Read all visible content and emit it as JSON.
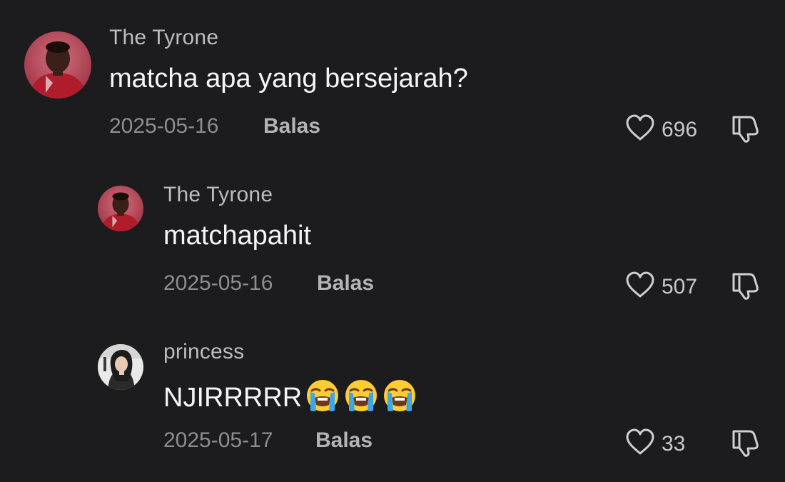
{
  "comments": [
    {
      "username": "The Tyrone",
      "text": "matcha apa yang bersejarah?",
      "date": "2025-05-16",
      "reply_label": "Balas",
      "likes": "696",
      "avatar": "person-red-jersey-avatar"
    },
    {
      "username": "The Tyrone",
      "text": "matchapahit",
      "date": "2025-05-16",
      "reply_label": "Balas",
      "likes": "507",
      "avatar": "person-red-jersey-avatar"
    },
    {
      "username": "princess",
      "text": "NJIRRRRR",
      "emojis": [
        "loudly-crying-face",
        "loudly-crying-face",
        "loudly-crying-face"
      ],
      "date": "2025-05-17",
      "reply_label": "Balas",
      "likes": "33",
      "avatar": "girl-photo-avatar"
    }
  ],
  "icons": {
    "like": "heart-outline-icon",
    "dislike": "thumbs-down-icon"
  },
  "colors": {
    "background": "#1c1c1e",
    "text": "#f5f5f5",
    "muted": "#8e8e8e"
  }
}
